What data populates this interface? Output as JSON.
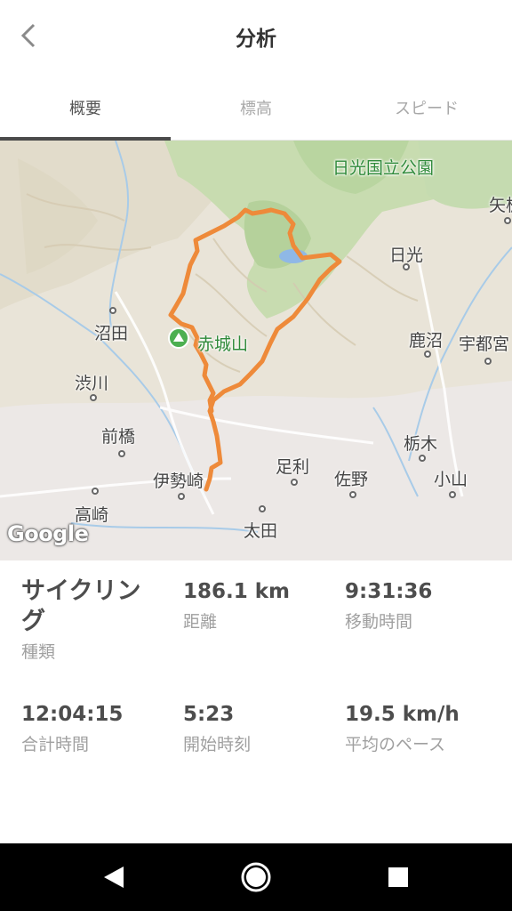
{
  "header": {
    "title": "分析",
    "back_icon": "chevron-left-icon"
  },
  "tabs": [
    {
      "label": "概要",
      "active": true
    },
    {
      "label": "標高",
      "active": false
    },
    {
      "label": "スピード",
      "active": false
    }
  ],
  "map": {
    "route_color": "#ee8a3a",
    "labels": {
      "nikko_park": "日光国立公園",
      "nikko": "日光",
      "yaita": "矢板",
      "numata": "沼田",
      "akagi": "赤城山",
      "kanuma": "鹿沼",
      "utsunomiya": "宇都宮",
      "shibukawa": "渋川",
      "maebashi": "前橋",
      "tochigi": "栃木",
      "ashikaga": "足利",
      "isesaki": "伊勢崎",
      "sano": "佐野",
      "oyama": "小山",
      "takasaki": "高崎",
      "ota": "太田"
    },
    "attribution": "Google"
  },
  "stats": {
    "type": {
      "value": "サイクリング",
      "label": "種類"
    },
    "distance": {
      "value": "186.1 km",
      "label": "距離"
    },
    "moving_time": {
      "value": "9:31:36",
      "label": "移動時間"
    },
    "total_time": {
      "value": "12:04:15",
      "label": "合計時間"
    },
    "start_time": {
      "value": "5:23",
      "label": "開始時刻"
    },
    "avg_pace": {
      "value": "19.5 km/h",
      "label": "平均のペース"
    }
  },
  "navbar": {
    "back": "triangle-back-icon",
    "home": "circle-home-icon",
    "recents": "square-recents-icon"
  }
}
